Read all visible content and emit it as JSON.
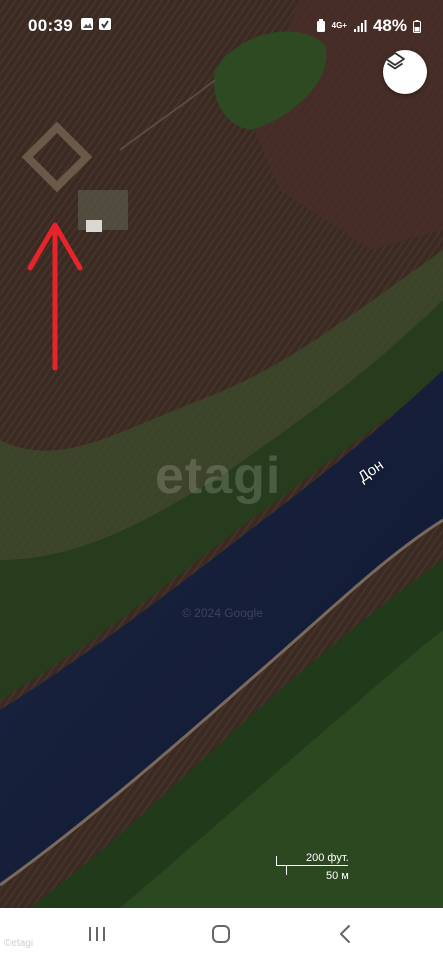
{
  "status_bar": {
    "time": "00:39",
    "network": "4G+",
    "battery": "48%",
    "icons": [
      "gallery-icon",
      "checkbox-icon",
      "battery-saver-icon",
      "signal-icon",
      "battery-icon"
    ]
  },
  "map": {
    "layers_icon": "layers-icon",
    "river_label": "Дон",
    "watermark": "etagi",
    "copyright": "© 2024 Google",
    "scale": {
      "feet_label": "200 фут.",
      "meters_label": "50 м"
    },
    "annotation": {
      "type": "arrow",
      "color": "#e8232b"
    }
  },
  "nav_bar": {
    "recents_icon": "recents-icon",
    "home_icon": "home-icon",
    "back_icon": "back-icon"
  },
  "corner_mark": "©etagi"
}
